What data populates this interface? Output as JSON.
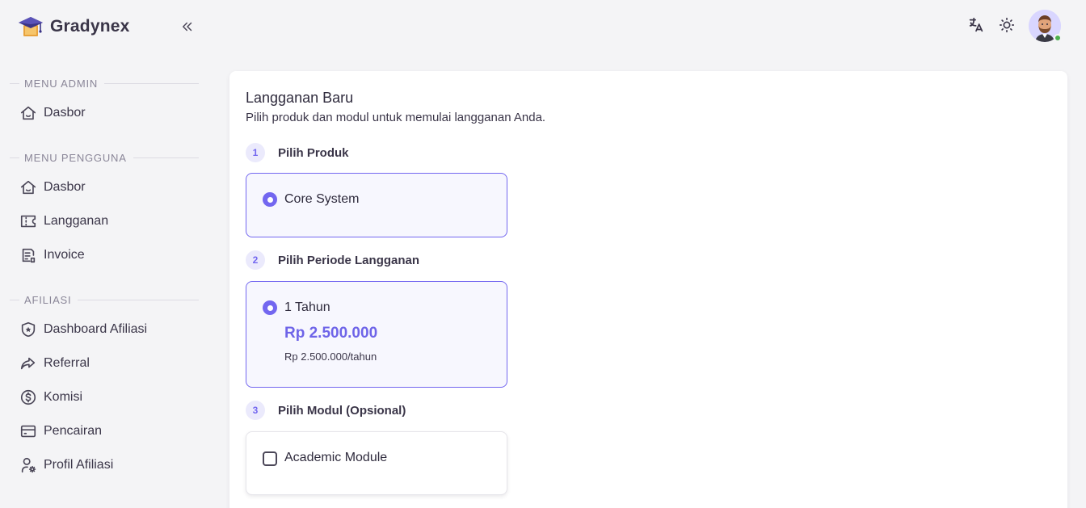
{
  "brand": {
    "name": "Gradynex"
  },
  "sidebar": {
    "sections": [
      {
        "label": "MENU ADMIN",
        "items": [
          {
            "label": "Dasbor",
            "icon": "home-icon"
          }
        ]
      },
      {
        "label": "MENU PENGGUNA",
        "items": [
          {
            "label": "Dasbor",
            "icon": "home-icon"
          },
          {
            "label": "Langganan",
            "icon": "ticket-icon"
          },
          {
            "label": "Invoice",
            "icon": "invoice-icon"
          }
        ]
      },
      {
        "label": "AFILIASI",
        "items": [
          {
            "label": "Dashboard Afiliasi",
            "icon": "shield-star-icon"
          },
          {
            "label": "Referral",
            "icon": "share-arrow-icon"
          },
          {
            "label": "Komisi",
            "icon": "dollar-circle-icon"
          },
          {
            "label": "Pencairan",
            "icon": "credit-card-icon"
          },
          {
            "label": "Profil Afiliasi",
            "icon": "user-cog-icon"
          }
        ]
      }
    ]
  },
  "topbar": {
    "icons": [
      "translate-icon",
      "sun-icon"
    ],
    "user_online": true
  },
  "page": {
    "title": "Langganan Baru",
    "subtitle": "Pilih produk dan modul untuk memulai langganan Anda.",
    "steps": [
      {
        "number": "1",
        "title": "Pilih Produk"
      },
      {
        "number": "2",
        "title": "Pilih Periode Langganan"
      },
      {
        "number": "3",
        "title": "Pilih Modul (Opsional)"
      }
    ],
    "product_option": {
      "label": "Core System",
      "selected": true
    },
    "period_option": {
      "label": "1 Tahun",
      "price": "Rp 2.500.000",
      "price_note": "Rp 2.500.000/tahun",
      "selected": true
    },
    "module_option": {
      "label": "Academic Module",
      "checked": false
    }
  },
  "colors": {
    "accent": "#7367f0",
    "background": "#f4f4f6",
    "card": "#ffffff",
    "online": "#4caf50"
  }
}
